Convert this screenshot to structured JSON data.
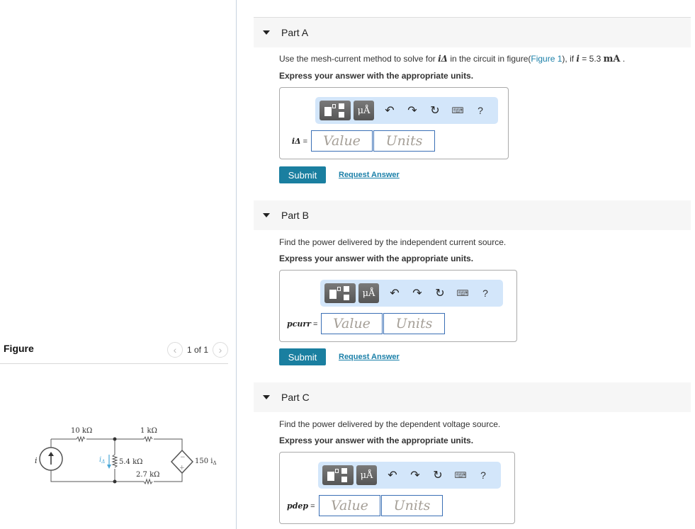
{
  "figure": {
    "title": "Figure",
    "pager_text": "1 of 1",
    "prev_icon": "chevron-left-icon",
    "next_icon": "chevron-right-icon",
    "circuit": {
      "r1": "10 kΩ",
      "r2": "1 kΩ",
      "r3": "5.4 kΩ",
      "r4": "2.7 kΩ",
      "source_label": "i",
      "dep_source_label": "150 i",
      "dep_source_sub": "Δ",
      "current_label": "i",
      "current_sub": "Δ",
      "minus": "−",
      "plus": "+"
    }
  },
  "parts": [
    {
      "title": "Part A",
      "prompt_pre": "Use the mesh-current method to solve for ",
      "prompt_var": "iΔ",
      "prompt_mid": " in the circuit in figure(",
      "prompt_link": "Figure 1",
      "prompt_mid2": "), if ",
      "prompt_var2": "i",
      "prompt_eq": " = 5.3 ",
      "prompt_unit": "mA",
      "prompt_end": " .",
      "express": "Express your answer with the appropriate units.",
      "lhs": "iΔ",
      "value_placeholder": "Value",
      "units_placeholder": "Units",
      "submit": "Submit",
      "request": "Request Answer"
    },
    {
      "title": "Part B",
      "prompt": "Find the power delivered by the independent current source.",
      "express": "Express your answer with the appropriate units.",
      "lhs": "pcurr",
      "value_placeholder": "Value",
      "units_placeholder": "Units",
      "submit": "Submit",
      "request": "Request Answer"
    },
    {
      "title": "Part C",
      "prompt": "Find the power delivered by the dependent voltage source.",
      "express": "Express your answer with the appropriate units.",
      "lhs": "pdep",
      "value_placeholder": "Value",
      "units_placeholder": "Units"
    }
  ],
  "toolbar": {
    "units_label": "μÅ",
    "undo": "↶",
    "redo": "↷",
    "reset": "↻",
    "keyboard": "⌨",
    "help": "?"
  },
  "equals": "="
}
